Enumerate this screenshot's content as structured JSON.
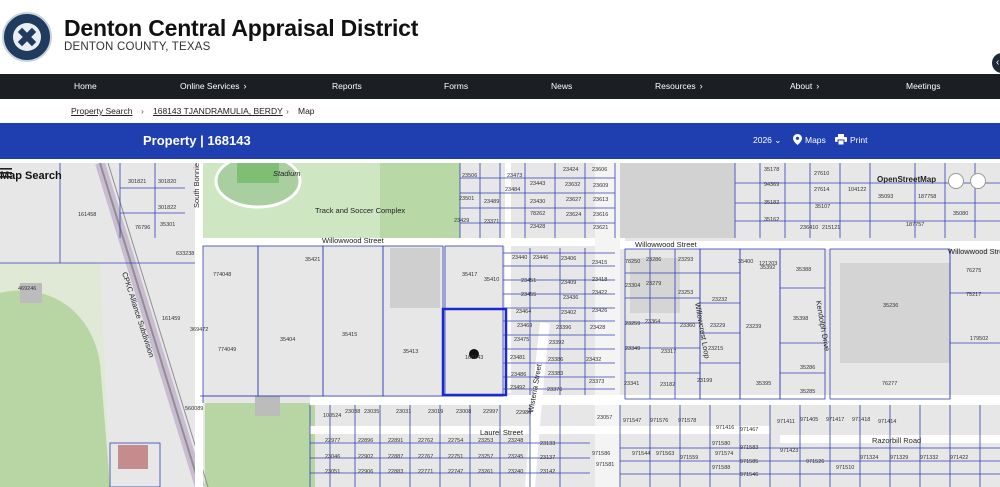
{
  "header": {
    "title": "Denton Central Appraisal District",
    "subtitle": "DENTON COUNTY, TEXAS"
  },
  "nav": {
    "items": [
      {
        "label": "Home",
        "chevron": false
      },
      {
        "label": "Online Services",
        "chevron": true
      },
      {
        "label": "Reports",
        "chevron": false
      },
      {
        "label": "Forms",
        "chevron": false
      },
      {
        "label": "News",
        "chevron": false
      },
      {
        "label": "Resources",
        "chevron": true
      },
      {
        "label": "About",
        "chevron": true
      },
      {
        "label": "Meetings",
        "chevron": false
      }
    ]
  },
  "breadcrumb": {
    "items": [
      "Property Search",
      "168143 TJANDRAMULIA, BERDY",
      "Map"
    ],
    "separator": "›"
  },
  "property_bar": {
    "title": "Property | 168143",
    "year": "2026",
    "maps_label": "Maps",
    "print_label": "Print"
  },
  "map": {
    "search_label": "Map Search",
    "attribution": "OpenStreetMap",
    "streets": [
      "Willowwood Street",
      "Willowwood Street",
      "Willowwood Street",
      "Laurel Street",
      "Razorbill Road",
      "Wisteria Street",
      "Kendolph Drive",
      "Willowcrest Loop",
      "South Bonnie",
      "CPKC Alliance Subdivision",
      "Track and Soccer Complex",
      "Stadium"
    ],
    "parcels": [
      "301821",
      "301820",
      "161458",
      "301822",
      "76796",
      "35301",
      "633238",
      "469246",
      "774048",
      "161459",
      "369472",
      "774049",
      "560089",
      "35421",
      "35404",
      "35415",
      "35413",
      "168143",
      "35417",
      "35410",
      "23506",
      "23473",
      "23484",
      "23443",
      "23489",
      "23501",
      "23430",
      "23429",
      "78262",
      "23371",
      "23428",
      "23440",
      "23446",
      "23451",
      "23455",
      "23464",
      "23469",
      "23475",
      "23481",
      "23486",
      "23492",
      "23406",
      "23409",
      "23415",
      "23418",
      "23422",
      "23426",
      "23428",
      "23432",
      "23436",
      "23402",
      "23396",
      "23392",
      "23386",
      "23383",
      "23376",
      "23373",
      "23424",
      "23606",
      "23632",
      "23609",
      "23627",
      "23613",
      "23624",
      "23616",
      "23621",
      "78250",
      "23286",
      "23293",
      "23304",
      "23279",
      "23253",
      "23259",
      "23364",
      "23360",
      "23349",
      "23317",
      "23341",
      "23182",
      "23199",
      "23215",
      "23229",
      "23232",
      "23239",
      "121203",
      "35395",
      "35400",
      "35392",
      "35388",
      "35398",
      "35286",
      "35285",
      "35178",
      "94369",
      "35182",
      "35162",
      "27610",
      "27614",
      "104122",
      "35107",
      "35093",
      "187758",
      "236410",
      "215121",
      "187757",
      "35080",
      "35236",
      "76277",
      "76275",
      "75217",
      "179502",
      "100524",
      "23038",
      "23035",
      "23031",
      "23019",
      "23008",
      "22997",
      "22986",
      "22977",
      "22896",
      "22891",
      "22762",
      "22754",
      "23253",
      "23248",
      "23133",
      "23046",
      "22902",
      "22887",
      "22767",
      "22751",
      "23257",
      "23245",
      "23137",
      "23051",
      "22906",
      "22883",
      "22771",
      "22747",
      "23261",
      "23240",
      "23142",
      "23057",
      "971547",
      "971576",
      "971578",
      "971580",
      "971583",
      "971586",
      "971581",
      "971544",
      "971563",
      "971559",
      "971574",
      "971585",
      "971588",
      "971546",
      "971423",
      "971526",
      "971510",
      "971324",
      "971329",
      "971332",
      "971422",
      "971411",
      "971405",
      "971417",
      "971418",
      "971414",
      "971416",
      "971467",
      "971465"
    ],
    "subject_parcel": "168143"
  },
  "colors": {
    "nav_bg": "#1b1f24",
    "property_bar_bg": "#1f3fb0",
    "parcel_line": "#3340b5",
    "subject_outline": "#1a2ad0"
  }
}
